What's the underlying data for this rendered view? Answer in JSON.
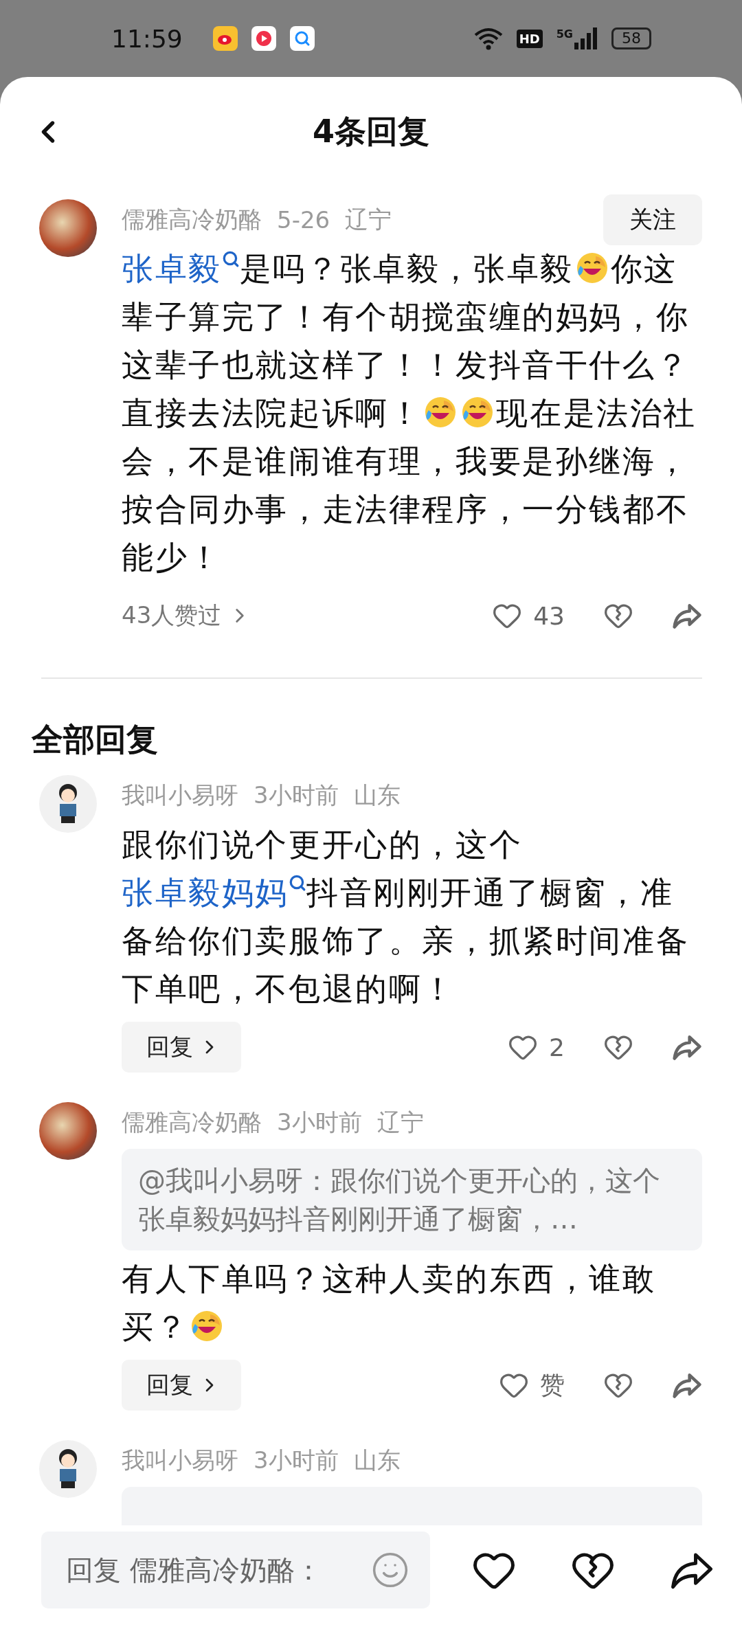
{
  "status_bar": {
    "time": "11:59",
    "network_badge": "HD",
    "network_type": "5G",
    "battery": "58"
  },
  "header": {
    "title": "4条回复"
  },
  "main_comment": {
    "author": "儒雅高冷奶酪",
    "date": "5-26",
    "location": "辽宁",
    "follow_button": "关注",
    "body": [
      {
        "kind": "link",
        "text": "张卓毅"
      },
      {
        "kind": "text",
        "text": "是吗？张卓毅，张卓毅"
      },
      {
        "kind": "emoji"
      },
      {
        "kind": "text",
        "text": "你这辈子算完了！有个胡搅蛮缠的妈妈，你这辈子也就这样了！！发抖音干什么？直接去法院起诉啊！"
      },
      {
        "kind": "emoji"
      },
      {
        "kind": "emoji"
      },
      {
        "kind": "text",
        "text": "现在是法治社会，不是谁闹谁有理，我要是孙继海，按合同办事，走法律程序，一分钱都不能少！"
      }
    ],
    "likes_summary": "43人赞过",
    "like_count": "43"
  },
  "section_title": "全部回复",
  "replies": [
    {
      "author": "我叫小易呀",
      "time": "3小时前",
      "location": "山东",
      "kind": "cartoon",
      "body": [
        {
          "kind": "text",
          "text": "跟你们说个更开心的，这个"
        },
        {
          "kind": "link",
          "text": "张卓毅妈妈"
        },
        {
          "kind": "text",
          "text": "抖音刚刚开通了橱窗，准备给你们卖服饰了。亲，抓紧时间准备下单吧，不包退的啊！"
        }
      ],
      "reply_button": "回复",
      "like_label": "2"
    },
    {
      "author": "儒雅高冷奶酪",
      "time": "3小时前",
      "location": "辽宁",
      "kind": "painting",
      "quote": "@我叫小易呀：跟你们说个更开心的，这个张卓毅妈妈抖音刚刚开通了橱窗，…",
      "body": [
        {
          "kind": "text",
          "text": "有人下单吗？这种人卖的东西，谁敢买？"
        },
        {
          "kind": "emoji"
        }
      ],
      "reply_button": "回复",
      "like_label": "赞"
    },
    {
      "author": "我叫小易呀",
      "time": "3小时前",
      "location": "山东",
      "kind": "cartoon",
      "quote_hidden": true
    }
  ],
  "reply_bar": {
    "placeholder": "回复 儒雅高冷奶酪："
  }
}
